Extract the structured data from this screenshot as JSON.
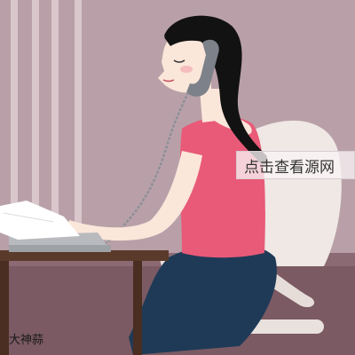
{
  "overlay": {
    "label": "点击查看源网"
  },
  "watermark": {
    "text": "大神蒜"
  },
  "illustration": {
    "icons": [
      "woman-on-phone-illustration",
      "telephone-icon",
      "office-chair-icon",
      "desk-icon",
      "papers-icon"
    ],
    "colors": {
      "background": "#b9a0a8",
      "wall_stripes": "#d9c7cc",
      "floor": "#7b5a63",
      "shirt": "#e85a78",
      "skirt": "#1f3a57",
      "hair": "#121212",
      "skin": "#fbe6da",
      "chair": "#efe8e4",
      "desk": "#5a3a2a",
      "phone": "#7d8189"
    }
  }
}
